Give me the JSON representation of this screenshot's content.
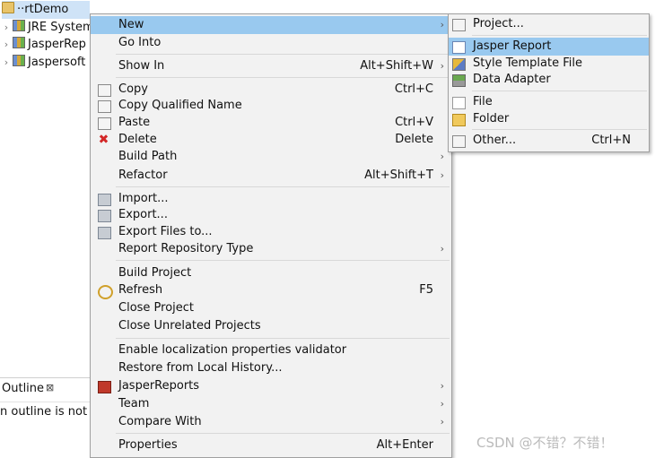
{
  "tree": {
    "rows": [
      {
        "label": "··rtDemo",
        "chev": ""
      },
      {
        "label": "JRE System",
        "chev": "›"
      },
      {
        "label": "JasperRep",
        "chev": "›"
      },
      {
        "label": "Jaspersoft",
        "chev": "›"
      }
    ]
  },
  "outline": {
    "tab_label": "Outline",
    "close": "⊠",
    "message": "n outline is not av"
  },
  "context_menu": {
    "items": [
      {
        "label": "New",
        "arrow": "›"
      },
      {
        "label": "Go Into"
      },
      {
        "label": "Show In",
        "accel": "Alt+Shift+W",
        "arrow": "›"
      },
      {
        "label": "Copy",
        "accel": "Ctrl+C"
      },
      {
        "label": "Copy Qualified Name"
      },
      {
        "label": "Paste",
        "accel": "Ctrl+V"
      },
      {
        "label": "Delete",
        "accel": "Delete"
      },
      {
        "label": "Build Path",
        "arrow": "›"
      },
      {
        "label": "Refactor",
        "accel": "Alt+Shift+T",
        "arrow": "›"
      },
      {
        "label": "Import..."
      },
      {
        "label": "Export..."
      },
      {
        "label": "Export Files to..."
      },
      {
        "label": "Report Repository Type",
        "arrow": "›"
      },
      {
        "label": "Build Project"
      },
      {
        "label": "Refresh",
        "accel": "F5"
      },
      {
        "label": "Close Project"
      },
      {
        "label": "Close Unrelated Projects"
      },
      {
        "label": "Enable localization properties validator"
      },
      {
        "label": "Restore from Local History..."
      },
      {
        "label": "JasperReports",
        "arrow": "›"
      },
      {
        "label": "Team",
        "arrow": "›"
      },
      {
        "label": "Compare With",
        "arrow": "›"
      },
      {
        "label": "Properties",
        "accel": "Alt+Enter"
      }
    ]
  },
  "new_submenu": {
    "items": [
      {
        "label": "Project..."
      },
      {
        "label": "Jasper Report"
      },
      {
        "label": "Style Template File"
      },
      {
        "label": "Data Adapter"
      },
      {
        "label": "File"
      },
      {
        "label": "Folder"
      },
      {
        "label": "Other...",
        "accel": "Ctrl+N"
      }
    ]
  },
  "watermark": "CSDN @不错？不错！"
}
